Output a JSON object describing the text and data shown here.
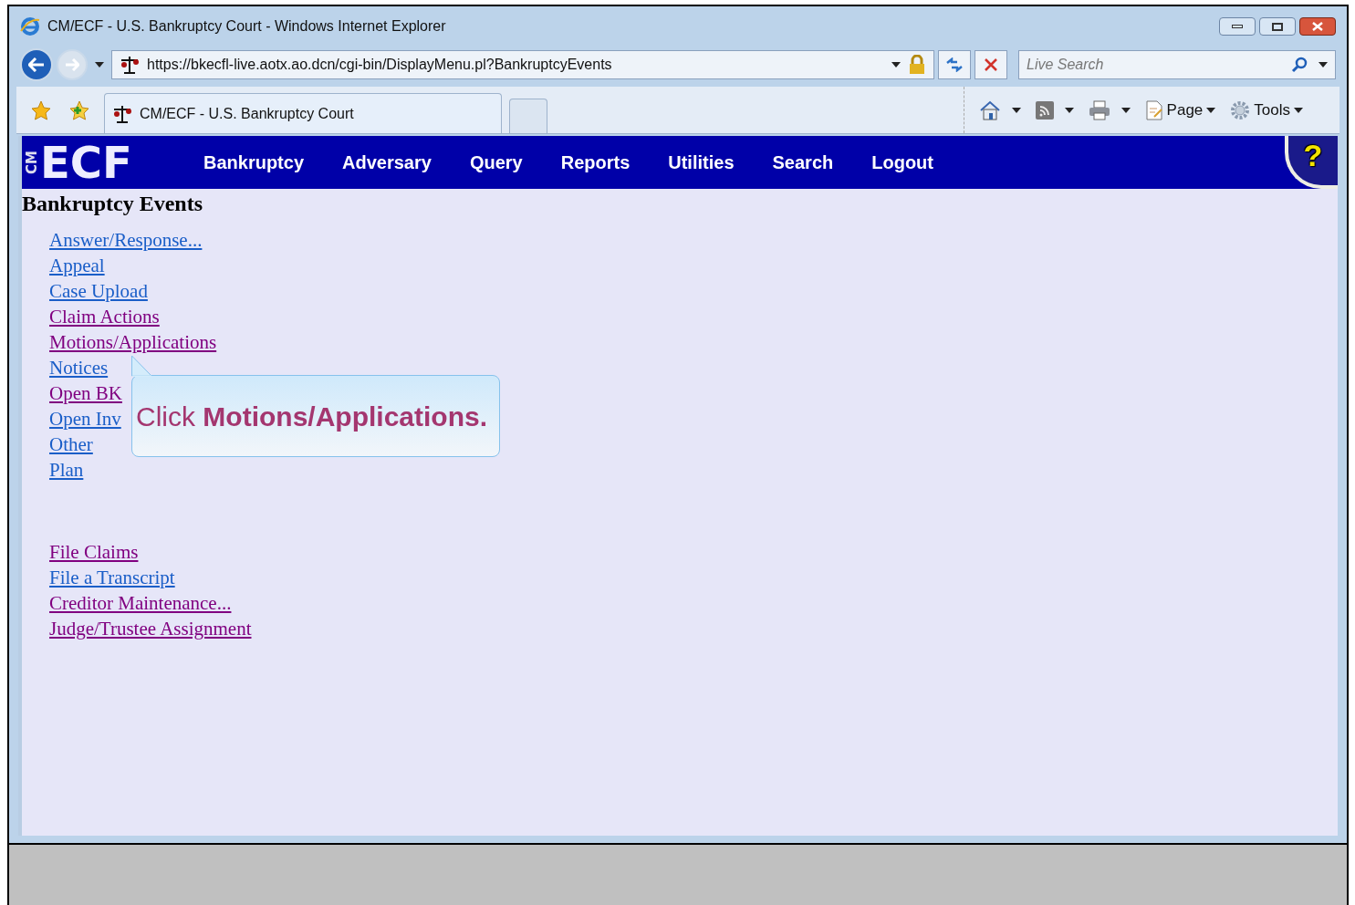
{
  "window": {
    "title": "CM/ECF - U.S. Bankruptcy Court - Windows Internet Explorer"
  },
  "address_bar": {
    "url": "https://bkecfl-live.aotx.ao.dcn/cgi-bin/DisplayMenu.pl?BankruptcyEvents"
  },
  "search": {
    "placeholder": "Live Search"
  },
  "tabs": [
    {
      "label": "CM/ECF - U.S. Bankruptcy Court",
      "selected": true
    }
  ],
  "command_bar": [
    {
      "label": "Page"
    },
    {
      "label": "Tools"
    }
  ],
  "site_nav": {
    "logo_small": "CM",
    "logo": "ECF",
    "help": "?",
    "items": [
      "Bankruptcy",
      "Adversary",
      "Query",
      "Reports",
      "Utilities",
      "Search",
      "Logout"
    ]
  },
  "page": {
    "heading": "Bankruptcy Events",
    "groups": [
      [
        {
          "label": "Answer/Response...",
          "visited": false
        },
        {
          "label": "Appeal",
          "visited": false
        },
        {
          "label": "Case Upload",
          "visited": false
        },
        {
          "label": "Claim Actions",
          "visited": true
        },
        {
          "label": "Motions/Applications",
          "visited": true
        },
        {
          "label": "Notices",
          "visited": false
        },
        {
          "label": "Open BK",
          "visited": true
        },
        {
          "label": "Open Inv",
          "visited": false
        },
        {
          "label": "Other",
          "visited": false
        },
        {
          "label": "Plan",
          "visited": false
        }
      ],
      [
        {
          "label": "File Claims",
          "visited": true
        },
        {
          "label": "File a Transcript",
          "visited": false
        },
        {
          "label": "Creditor Maintenance...",
          "visited": true
        },
        {
          "label": "Judge/Trustee Assignment",
          "visited": true
        }
      ]
    ]
  },
  "callout": {
    "text": "Click **Motions/Applications.**"
  }
}
